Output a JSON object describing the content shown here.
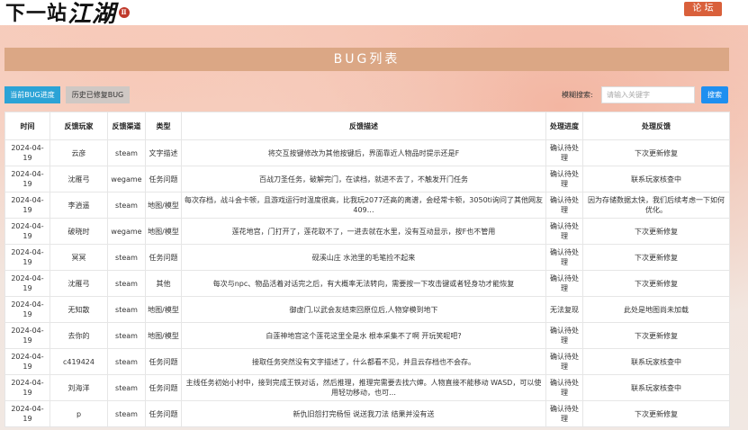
{
  "header": {
    "logo_text_1": "下一站",
    "logo_text_2": "江湖",
    "logo_seal": "Ⅱ",
    "forum_button": "论 坛"
  },
  "page_title": "BUG列表",
  "tabs": [
    {
      "label": "当前BUG进度",
      "active": true
    },
    {
      "label": "历史已修复BUG",
      "active": false
    }
  ],
  "search": {
    "label": "模糊搜索:",
    "placeholder": "请输入关键字",
    "button": "搜索"
  },
  "table": {
    "columns": [
      "时间",
      "反馈玩家",
      "反馈渠道",
      "类型",
      "反馈描述",
      "处理进度",
      "处理反馈"
    ],
    "rows": [
      [
        "2024-04-19",
        "云彦",
        "steam",
        "文字描述",
        "将交互按键修改为其他按键后，界面靠近人物品时提示还是F",
        "确认待处理",
        "下次更新修复"
      ],
      [
        "2024-04-19",
        "沈雁弓",
        "wegame",
        "任务问题",
        "百战刀圣任务，破解完门，在读档，就进不去了，不触发开门任务",
        "确认待处理",
        "联系玩家核查中"
      ],
      [
        "2024-04-19",
        "李逍遥",
        "steam",
        "地图/模型",
        "每次存档，战斗会卡顿，且游戏运行时温度很高，比我玩2077还高的离谱，会经常卡顿，3050ti询问了其他网友409…",
        "确认待处理",
        "因为存储数据太快，我们后续考虑一下如何优化。"
      ],
      [
        "2024-04-19",
        "破晓时",
        "wegame",
        "地图/模型",
        "莲花地宫，门打开了，莲花取不了，一进去就在水里，没有互动显示，按F也不管用",
        "确认待处理",
        "下次更新修复"
      ],
      [
        "2024-04-19",
        "冥冥",
        "steam",
        "任务问题",
        "砚溪山庄 水池里的毛笔捡不起来",
        "确认待处理",
        "下次更新修复"
      ],
      [
        "2024-04-19",
        "沈雁弓",
        "steam",
        "其他",
        "每次与npc、物品活着对话完之后，有大概率无法转向，需要按一下攻击键或者轻身功才能恢复",
        "确认待处理",
        "下次更新修复"
      ],
      [
        "2024-04-19",
        "无知散",
        "steam",
        "地图/模型",
        "御虚门,以武会友结束回原位后,人物穿模到地下",
        "无法复现",
        "此处是地图尚未加载"
      ],
      [
        "2024-04-19",
        "去你的",
        "steam",
        "地图/模型",
        "白莲神地宫这个莲花这里全是水 根本采集不了啊 开玩笑呢吧?",
        "确认待处理",
        "下次更新修复"
      ],
      [
        "2024-04-19",
        "c419424",
        "steam",
        "任务问题",
        "接取任务突然没有文字描述了，什么都看不见，并且云存档也不会存。",
        "确认待处理",
        "联系玩家核查中"
      ],
      [
        "2024-04-19",
        "刘海洋",
        "steam",
        "任务问题",
        "主线任务初始小村中，接到完成王铁对话，然后推理，推理完需要去找六婶。人物直接不能移动 WASD，可以使用轻功移动，也可…",
        "确认待处理",
        "联系玩家核查中"
      ],
      [
        "2024-04-19",
        "p",
        "steam",
        "任务问题",
        "新仇旧怨打完杨恒 说送我刀法 结果并没有送",
        "确认待处理",
        "下次更新修复"
      ]
    ]
  }
}
